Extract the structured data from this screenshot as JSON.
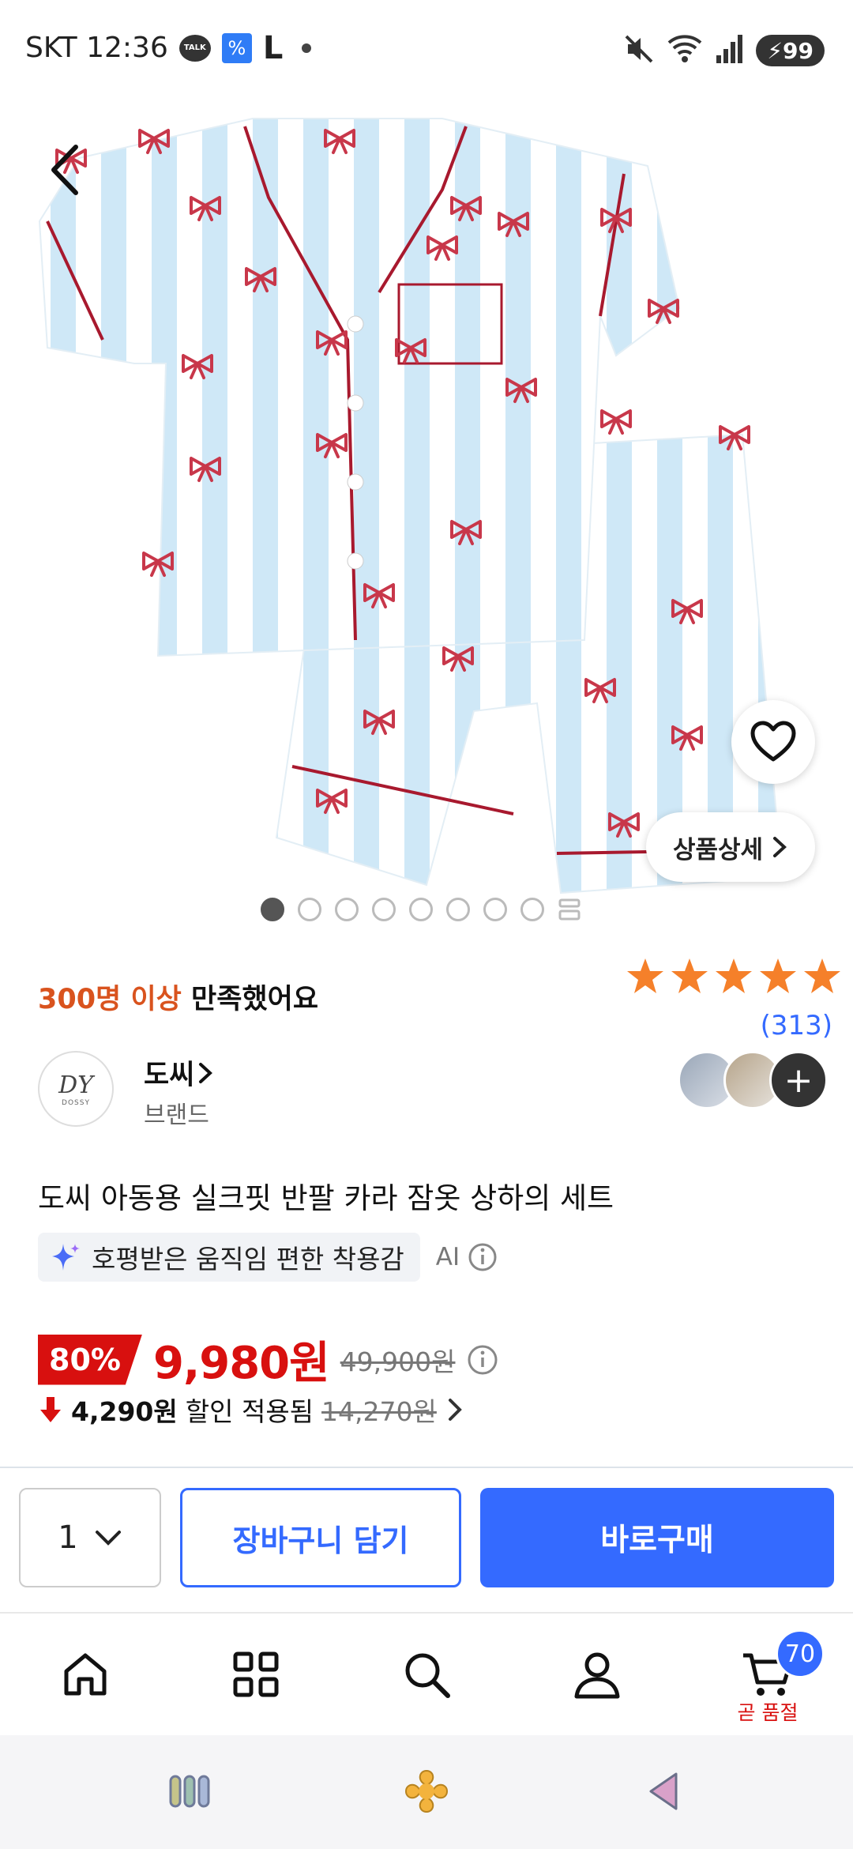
{
  "status_bar": {
    "carrier_time": "SKT 12:36",
    "talk_label": "TALK",
    "blue_icon_glyph": "%",
    "l_icon_glyph": "L",
    "battery": "99",
    "icons": [
      "kakaotalk-icon",
      "percent-app-icon",
      "l-app-icon",
      "mute-icon",
      "wifi-icon",
      "signal-icon",
      "battery-icon"
    ]
  },
  "product": {
    "pager": {
      "total": 8,
      "active_index": 0
    },
    "detail_button": "상품상세",
    "satisfaction_highlight": "300명 이상",
    "satisfaction_rest": " 만족했어요",
    "rating_stars": 5,
    "review_count": "(313)",
    "brand": {
      "name": "도씨",
      "sub": "브랜드",
      "logo_monogram": "DY",
      "logo_word": "DOSSY"
    },
    "title": "도씨 아동용 실크핏 반팔 카라 잠옷 상하의 세트",
    "ai_summary": "호평받은 움직임 편한 착용감",
    "ai_label": "AI",
    "discount": "80%",
    "sale_price": "9,980원",
    "original_price": "49,900원",
    "extra_discount_amount": "4,290원",
    "extra_discount_text": "할인 적용됨",
    "extra_original": "14,270원"
  },
  "buy_bar": {
    "quantity": "1",
    "cart_label": "장바구니 담기",
    "buy_label": "바로구매"
  },
  "bottom_nav": {
    "items": [
      "home-icon",
      "category-icon",
      "search-icon",
      "my-account-icon",
      "cart-icon"
    ],
    "cart_badge": "70",
    "cart_sublabel": "곧 품절"
  },
  "colors": {
    "accent_blue": "#346aff",
    "sale_red": "#d8100f",
    "highlight_orange": "#d9531e",
    "star_orange": "#f5802a",
    "stripe_blue": "#cfe8f7",
    "bow_red": "#c8374a"
  }
}
